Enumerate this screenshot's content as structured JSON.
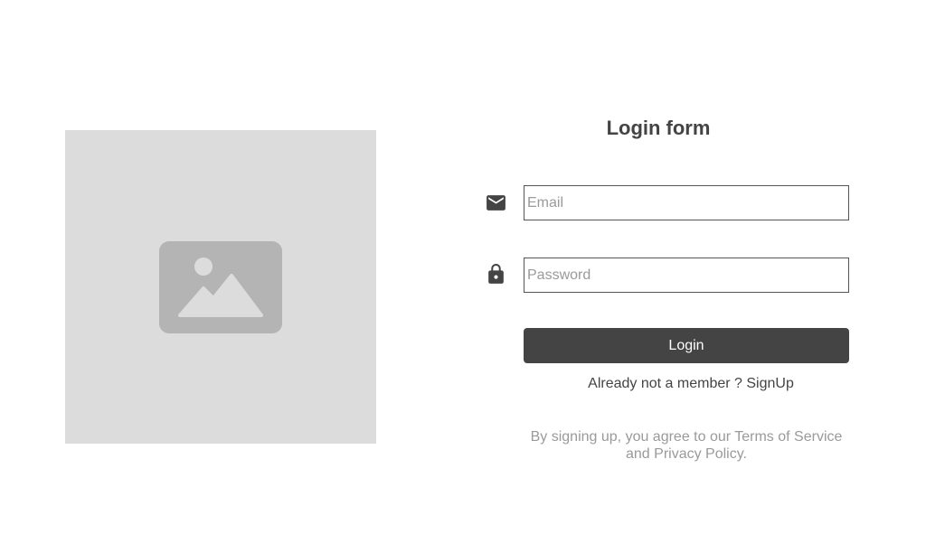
{
  "form": {
    "title": "Login form",
    "email": {
      "icon": "mail-icon",
      "placeholder": "Email",
      "value": ""
    },
    "password": {
      "icon": "lock-icon",
      "placeholder": "Password",
      "value": ""
    },
    "login_label": "Login",
    "signup_prompt": "Already not a member ?",
    "signup_link": "SignUp",
    "terms_prefix": "By signing up, you agree to our",
    "terms_link": "Terms of Service",
    "terms_joiner": "and",
    "privacy_link": "Privacy Policy",
    "terms_suffix": "."
  },
  "image_placeholder": {
    "icon": "image-icon"
  },
  "colors": {
    "text": "#444444",
    "button_bg": "#444444",
    "button_text": "#ffffff",
    "muted": "#9a9a9a",
    "placeholder_bg": "#dcdcdc",
    "placeholder_icon": "#b4b4b4"
  }
}
